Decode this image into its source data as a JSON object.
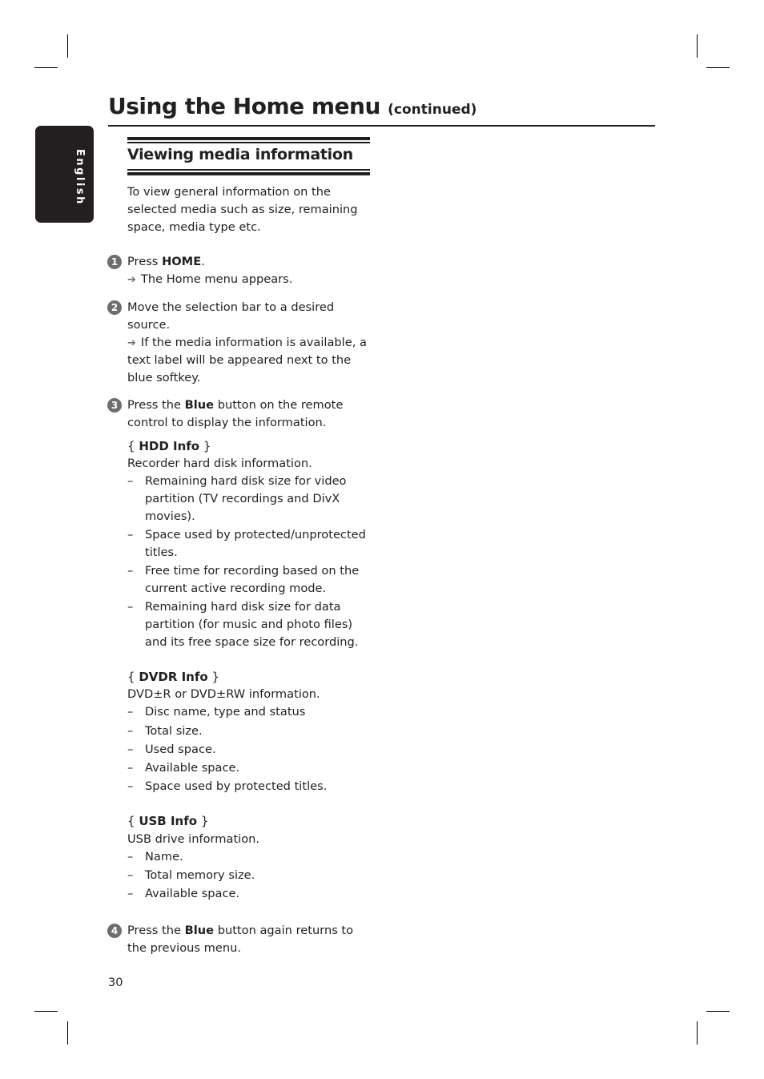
{
  "language_tab": {
    "label": "English"
  },
  "header": {
    "title": "Using the Home menu",
    "title_suffix": "(continued)"
  },
  "section": {
    "heading": "Viewing media information",
    "intro": "To view general information on the selected media such as size, remaining space, media type etc."
  },
  "steps": [
    {
      "number": "1",
      "text_before": "Press ",
      "bold": "HOME",
      "text_after": ".",
      "result": "The Home menu appears."
    },
    {
      "number": "2",
      "text": "Move the selection bar to a desired source.",
      "result": "If the media information is available, a text label will be appeared next to the blue softkey."
    },
    {
      "number": "3",
      "text_before": "Press the ",
      "bold": "Blue",
      "text_after": " button on the remote control to display the information."
    },
    {
      "number": "4",
      "text_before": "Press the ",
      "bold": "Blue",
      "text_after": " button again returns to the previous menu."
    }
  ],
  "options": [
    {
      "name": "HDD Info",
      "description": "Recorder hard disk information.",
      "items": [
        "Remaining hard disk size for video partition (TV recordings and DivX movies).",
        "Space used by protected/unprotected titles.",
        "Free time for recording based on the current active recording mode.",
        "Remaining hard disk size for data partition (for music and photo files) and its free space size for recording."
      ]
    },
    {
      "name": "DVDR Info",
      "description": "DVD±R or DVD±RW information.",
      "items": [
        "Disc name, type and status",
        "Total size.",
        "Used space.",
        "Available space.",
        "Space used by protected titles."
      ]
    },
    {
      "name": "USB Info",
      "description": "USB drive information.",
      "items": [
        "Name.",
        "Total memory size.",
        "Available space."
      ]
    }
  ],
  "brace_open": "{ ",
  "brace_close": " }",
  "arrow_glyph": "➔",
  "page_number": "30"
}
